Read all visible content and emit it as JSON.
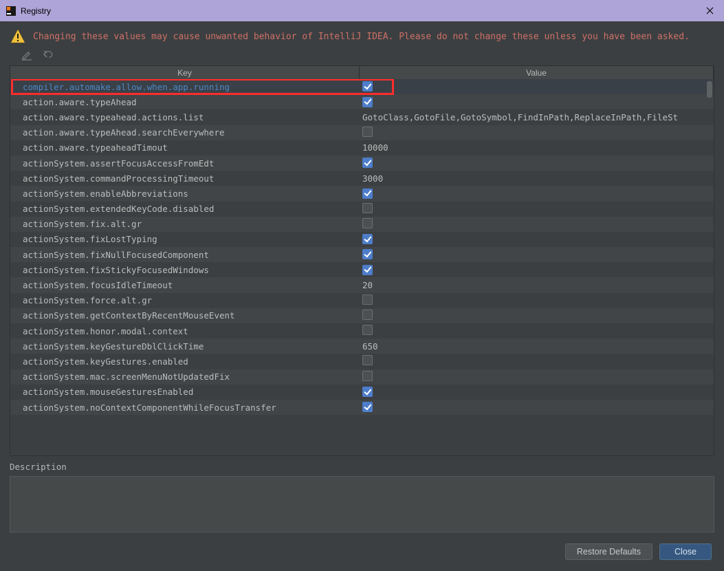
{
  "window": {
    "title": "Registry"
  },
  "warning": {
    "text": "Changing these values may cause unwanted behavior of IntelliJ IDEA. Please do not change these unless you have been asked."
  },
  "table": {
    "headers": {
      "key": "Key",
      "value": "Value"
    },
    "rows": [
      {
        "key": "compiler.automake.allow.when.app.running",
        "type": "bool",
        "checked": true,
        "selected": true
      },
      {
        "key": "action.aware.typeAhead",
        "type": "bool",
        "checked": true
      },
      {
        "key": "action.aware.typeahead.actions.list",
        "type": "text",
        "value": "GotoClass,GotoFile,GotoSymbol,FindInPath,ReplaceInPath,FileSt"
      },
      {
        "key": "action.aware.typeAhead.searchEverywhere",
        "type": "bool",
        "checked": false
      },
      {
        "key": "action.aware.typeaheadTimout",
        "type": "text",
        "value": "10000"
      },
      {
        "key": "actionSystem.assertFocusAccessFromEdt",
        "type": "bool",
        "checked": true
      },
      {
        "key": "actionSystem.commandProcessingTimeout",
        "type": "text",
        "value": "3000"
      },
      {
        "key": "actionSystem.enableAbbreviations",
        "type": "bool",
        "checked": true
      },
      {
        "key": "actionSystem.extendedKeyCode.disabled",
        "type": "bool",
        "checked": false
      },
      {
        "key": "actionSystem.fix.alt.gr",
        "type": "bool",
        "checked": false
      },
      {
        "key": "actionSystem.fixLostTyping",
        "type": "bool",
        "checked": true
      },
      {
        "key": "actionSystem.fixNullFocusedComponent",
        "type": "bool",
        "checked": true
      },
      {
        "key": "actionSystem.fixStickyFocusedWindows",
        "type": "bool",
        "checked": true
      },
      {
        "key": "actionSystem.focusIdleTimeout",
        "type": "text",
        "value": "20"
      },
      {
        "key": "actionSystem.force.alt.gr",
        "type": "bool",
        "checked": false
      },
      {
        "key": "actionSystem.getContextByRecentMouseEvent",
        "type": "bool",
        "checked": false
      },
      {
        "key": "actionSystem.honor.modal.context",
        "type": "bool",
        "checked": false
      },
      {
        "key": "actionSystem.keyGestureDblClickTime",
        "type": "text",
        "value": "650"
      },
      {
        "key": "actionSystem.keyGestures.enabled",
        "type": "bool",
        "checked": false
      },
      {
        "key": "actionSystem.mac.screenMenuNotUpdatedFix",
        "type": "bool",
        "checked": false
      },
      {
        "key": "actionSystem.mouseGesturesEnabled",
        "type": "bool",
        "checked": true
      },
      {
        "key": "actionSystem.noContextComponentWhileFocusTransfer",
        "type": "bool",
        "checked": true
      }
    ]
  },
  "description": {
    "label": "Description"
  },
  "footer": {
    "restore": "Restore Defaults",
    "close": "Close"
  }
}
